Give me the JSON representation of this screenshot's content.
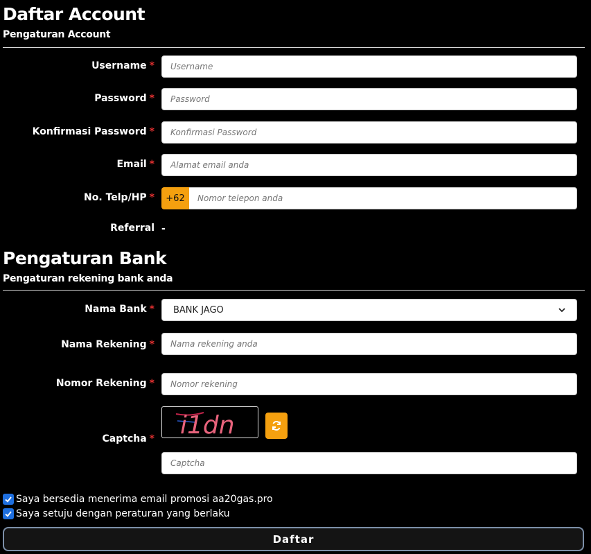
{
  "account": {
    "title": "Daftar Account",
    "subtitle": "Pengaturan Account",
    "fields": {
      "username": {
        "label": "Username",
        "placeholder": "Username"
      },
      "password": {
        "label": "Password",
        "placeholder": "Password"
      },
      "confirm": {
        "label": "Konfirmasi Password",
        "placeholder": "Konfirmasi Password"
      },
      "email": {
        "label": "Email",
        "placeholder": "Alamat email anda"
      },
      "phone": {
        "label": "No. Telp/HP",
        "prefix": "+62",
        "placeholder": "Nomor telepon anda"
      }
    },
    "referral": {
      "label": "Referral",
      "value": "-"
    },
    "required_mark": "*"
  },
  "bank": {
    "title": "Pengaturan Bank",
    "subtitle": "Pengaturan rekening bank anda",
    "bank_name": {
      "label": "Nama Bank",
      "selected": "BANK JAGO"
    },
    "account_name": {
      "label": "Nama Rekening",
      "placeholder": "Nama rekening anda"
    },
    "account_number": {
      "label": "Nomor Rekening",
      "placeholder": "Nomor rekening"
    },
    "captcha": {
      "label": "Captcha",
      "image_text": "i1dn",
      "placeholder": "Captcha"
    }
  },
  "agreements": {
    "promo": "Saya bersedia menerima email promosi aa20gas.pro",
    "terms": "Saya setuju dengan peraturan yang berlaku"
  },
  "submit_label": "Daftar",
  "colors": {
    "accent": "#f5a00f",
    "required": "#e03030",
    "checkbox": "#1e6fe0"
  }
}
